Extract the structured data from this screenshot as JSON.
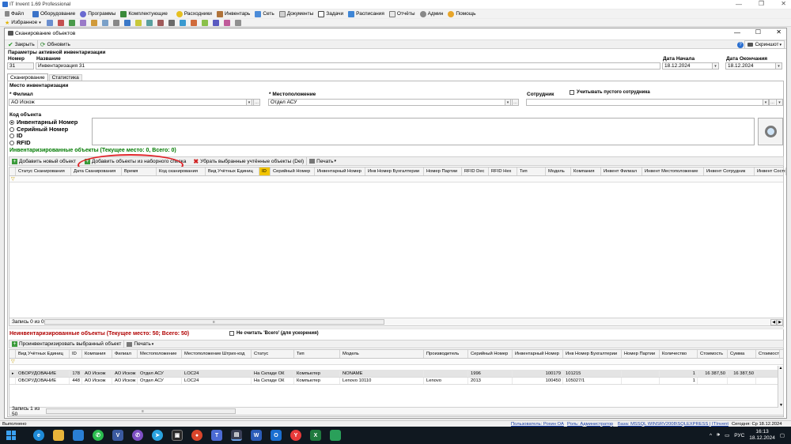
{
  "app": {
    "title": "IT Invent 1.69 Professional",
    "menu": [
      "Файл",
      "Оборудование",
      "Программы",
      "Комплектующие",
      "Расходники",
      "Инвентарь",
      "Сеть",
      "Документы",
      "Задачи",
      "Расписания",
      "Отчёты",
      "Админ",
      "Помощь"
    ],
    "favorites_label": "Избранное"
  },
  "dialog": {
    "title": "Сканирование объектов",
    "close_label": "Закрыть",
    "refresh_label": "Обновить",
    "screenshot_label": "Скриншот",
    "params_header": "Параметры активной инвентаризации",
    "number_label": "Номер",
    "number_value": "31",
    "name_label": "Название",
    "name_value": "Инвентаризация 31",
    "date_start_label": "Дата Начала",
    "date_start_value": "18.12.2024",
    "date_end_label": "Дата Окончания",
    "date_end_value": "18.12.2024",
    "tabs": [
      "Сканирование",
      "Статистика"
    ],
    "location_header": "Место инвентаризации",
    "branch_label": "* Филиал",
    "branch_value": "АО Искож",
    "place_label": "* Местоположение",
    "place_value": "Отдел АСУ",
    "employee_label": "Сотрудник",
    "employee_value": "",
    "empty_employee_label": "Учитывать пустого сотрудника",
    "code_header": "Код объекта",
    "code_options": [
      "Инвентарный Номер",
      "Серийный Номер",
      "ID",
      "RFID"
    ],
    "code_input_value": ""
  },
  "inventoried": {
    "title": "Инвентаризированные объекты (Текущее место: 0, Всего: 0)",
    "add_new_label": "Добавить новый объект",
    "add_from_list_label": "Добавить объекты из наборного списка",
    "remove_label": "Убрать выбранные учтённые объекты (Del)",
    "print_label": "Печать",
    "columns": [
      "Статус Сканирования",
      "Дата Сканирования",
      "Время",
      "Код сканирования",
      "Вид Учётных Единиц",
      "ID",
      "Серийный Номер",
      "Инвентарный Номер",
      "Инв Номер Бухгалтерии",
      "Номер Партии",
      "RFID Dec",
      "RFID Hex",
      "Тип",
      "Модель",
      "Компания",
      "Инвент Филиал",
      "Инвент Местоположение",
      "Инвент Сотрудник",
      "Инвент Состо"
    ],
    "record_label": "Запись 0 из 0"
  },
  "uninventoried": {
    "title": "Неинвентаризированные объекты (Текущее место: 50; Всего: 50)",
    "ignore_total_label": "Не считать 'Всего' (для ускорения)",
    "inventory_selected_label": "Проинвентаризировать выбранный объект",
    "print_label": "Печать",
    "columns": [
      "Вид Учётных Единиц",
      "ID",
      "Компания",
      "Филиал",
      "Местоположение",
      "Местоположение Штрих-код",
      "Статус",
      "Тип",
      "Модель",
      "Производитель",
      "Серийный Номер",
      "Инвентарный Номер",
      "Инв Номер Бухгалтерии",
      "Номер Партии",
      "Количество",
      "Стоимость",
      "Сумма",
      "Стоимость с с"
    ],
    "rows": [
      [
        "ОБОРУДОВАНИЕ",
        "178",
        "АО Искож",
        "АО Искож",
        "Отдел АСУ",
        "LOC24",
        "На Складе ОК",
        "Компьютер",
        "NONAME",
        "",
        "1996",
        "100179",
        "101215",
        "",
        "1",
        "16 387,50",
        "16 387,50",
        ""
      ],
      [
        "ОБОРУДОВАНИЕ",
        "448",
        "АО Искож",
        "АО Искож",
        "Отдел АСУ",
        "LOC24",
        "На Складе ОК",
        "Компьютер",
        "Lenovo 10110",
        "Lenovo",
        "2013",
        "100450",
        "105027/1",
        "",
        "1",
        "",
        "",
        ""
      ]
    ],
    "record_label": "Запись 1 из 50"
  },
  "status_bar": {
    "left": "Выполнено",
    "user": "Пользователь: Рохин ОА",
    "role": "Роль: Администратор",
    "db": "База: MSSQL WINSRV2008\\SQLEXPRESS | ITInvent",
    "today": "Сегодня: Ср 18.12.2024"
  },
  "taskbar": {
    "lang": "РУС",
    "time": "16:13",
    "date": "18.12.2024"
  },
  "colors": {
    "green_header": "#007a00",
    "red_header": "#b00000",
    "highlight": "#e0262b",
    "taskbar": "#101820"
  }
}
